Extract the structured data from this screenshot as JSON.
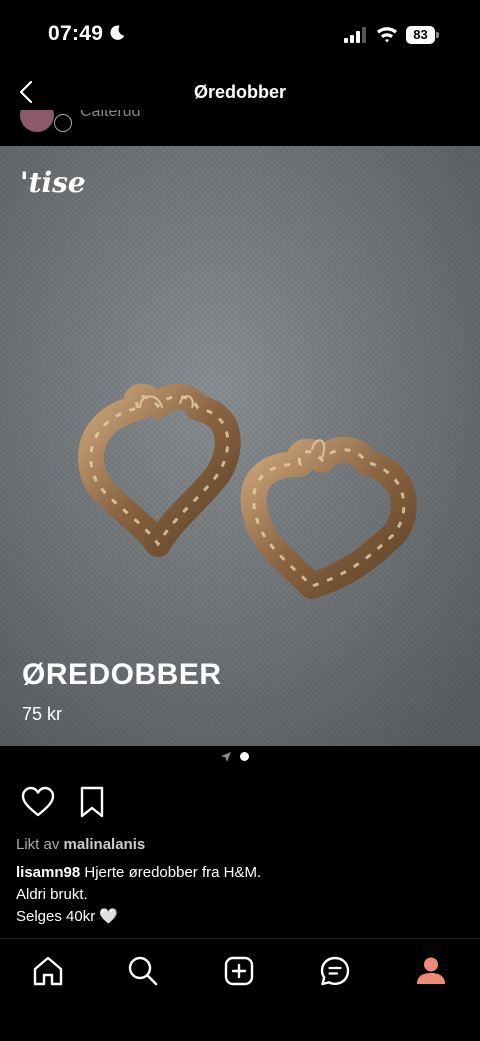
{
  "status": {
    "time": "07:49",
    "battery": "83"
  },
  "nav": {
    "title": "Øredobber"
  },
  "profile_peek": {
    "username": "Calterud"
  },
  "photo": {
    "watermark": "tise",
    "product_title": "ØREDOBBER",
    "price": "75 kr"
  },
  "pager": {
    "pages": 2,
    "current": 2
  },
  "likes": {
    "prefix": "Likt av",
    "user": "malinalanis"
  },
  "caption": {
    "user": "lisamn98",
    "line1": "Hjerte øredobber fra H&M.",
    "line2": "Aldri brukt.",
    "line3": "Selges 40kr 🤍"
  },
  "tabs": [
    "home-icon",
    "search-icon",
    "add-icon",
    "chat-icon",
    "profile-icon"
  ],
  "colors": {
    "profile_accent": "#f08a78",
    "background": "#000000"
  }
}
